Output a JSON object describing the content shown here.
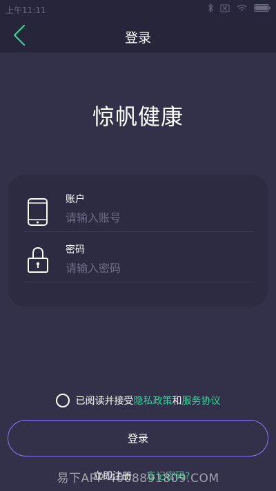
{
  "status_bar": {
    "time": "上午11:11"
  },
  "header": {
    "title": "登录",
    "back_icon": "chevron-left-icon",
    "accent": "#37d39a"
  },
  "brand": {
    "name": "惊帆健康"
  },
  "form": {
    "account": {
      "label": "账户",
      "placeholder": "请输入账号",
      "value": "",
      "icon": "phone-icon"
    },
    "password": {
      "label": "密码",
      "placeholder": "请输入密码",
      "value": "",
      "icon": "lock-icon"
    }
  },
  "agreement": {
    "prefix": "已阅读并接受",
    "privacy": "隐私政策",
    "and": "和",
    "service": "服务协议",
    "checked": false
  },
  "login_button": "登录",
  "register_link": "立即注册",
  "forgot_link": "忘记密码?",
  "watermark": "易下APP 4008891809.COM"
}
